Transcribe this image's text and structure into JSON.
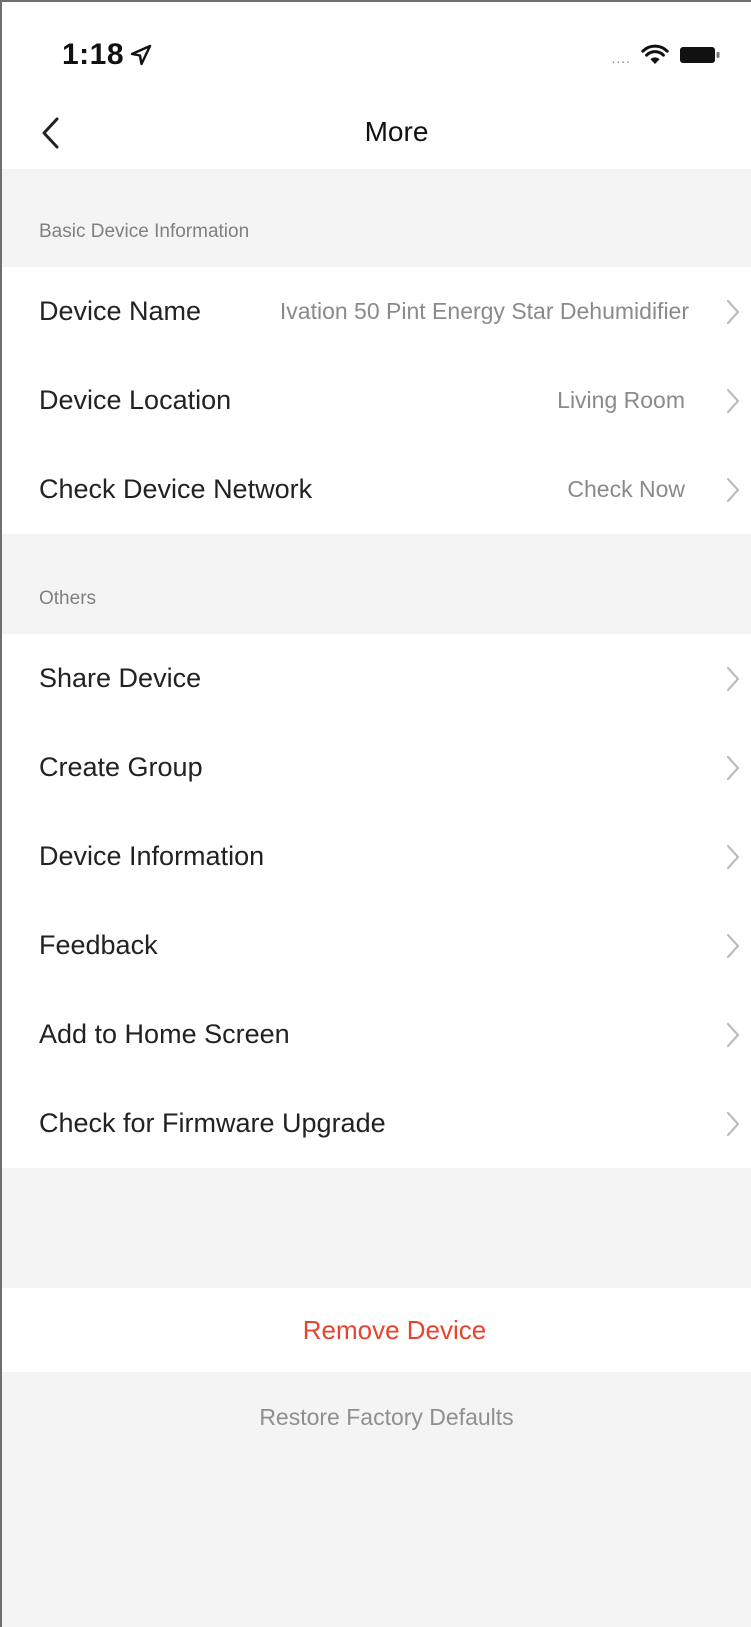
{
  "status_bar": {
    "time": "1:18",
    "signal": "....",
    "icons": [
      "location-arrow-icon",
      "wifi-icon",
      "battery-icon"
    ]
  },
  "nav": {
    "title": "More",
    "back_icon": "chevron-left-icon"
  },
  "sections": [
    {
      "header": "Basic Device Information",
      "items": [
        {
          "label": "Device Name",
          "value": "Ivation 50 Pint Energy Star Dehumidifier"
        },
        {
          "label": "Device Location",
          "value": "Living Room"
        },
        {
          "label": "Check Device Network",
          "value": "Check Now"
        }
      ]
    },
    {
      "header": "Others",
      "items": [
        {
          "label": "Share Device",
          "value": ""
        },
        {
          "label": "Create Group",
          "value": ""
        },
        {
          "label": "Device Information",
          "value": ""
        },
        {
          "label": "Feedback",
          "value": ""
        },
        {
          "label": "Add to Home Screen",
          "value": ""
        },
        {
          "label": "Check for Firmware Upgrade",
          "value": ""
        }
      ]
    }
  ],
  "actions": {
    "remove_device": "Remove Device",
    "restore_defaults": "Restore Factory Defaults"
  },
  "colors": {
    "background": "#f4f4f4",
    "row_background": "#ffffff",
    "destructive": "#e8432e",
    "secondary_text": "#8a8a8a"
  }
}
